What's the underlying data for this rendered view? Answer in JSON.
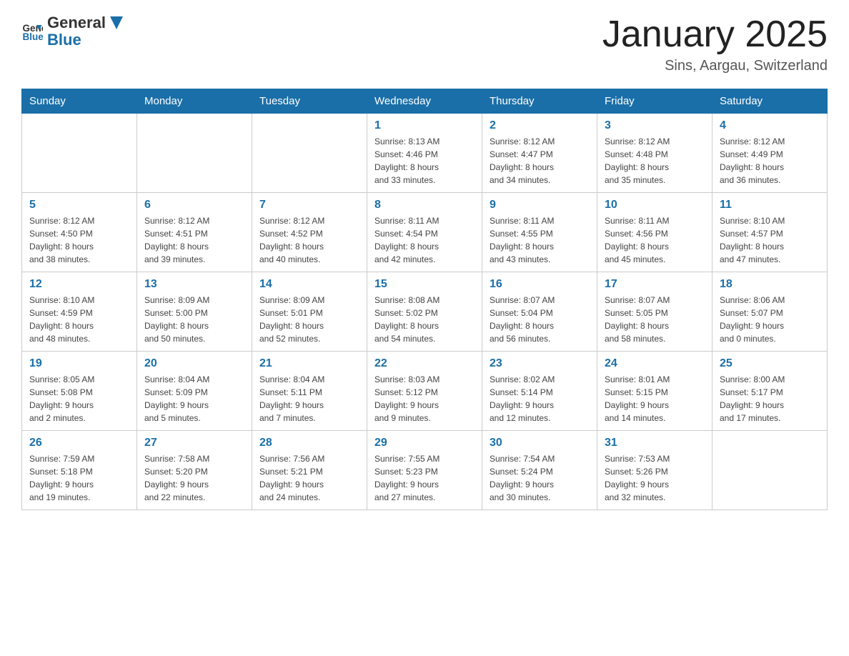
{
  "header": {
    "logo_general": "General",
    "logo_blue": "Blue",
    "title": "January 2025",
    "subtitle": "Sins, Aargau, Switzerland"
  },
  "days_of_week": [
    "Sunday",
    "Monday",
    "Tuesday",
    "Wednesday",
    "Thursday",
    "Friday",
    "Saturday"
  ],
  "weeks": [
    {
      "days": [
        {
          "number": "",
          "info": ""
        },
        {
          "number": "",
          "info": ""
        },
        {
          "number": "",
          "info": ""
        },
        {
          "number": "1",
          "info": "Sunrise: 8:13 AM\nSunset: 4:46 PM\nDaylight: 8 hours\nand 33 minutes."
        },
        {
          "number": "2",
          "info": "Sunrise: 8:12 AM\nSunset: 4:47 PM\nDaylight: 8 hours\nand 34 minutes."
        },
        {
          "number": "3",
          "info": "Sunrise: 8:12 AM\nSunset: 4:48 PM\nDaylight: 8 hours\nand 35 minutes."
        },
        {
          "number": "4",
          "info": "Sunrise: 8:12 AM\nSunset: 4:49 PM\nDaylight: 8 hours\nand 36 minutes."
        }
      ]
    },
    {
      "days": [
        {
          "number": "5",
          "info": "Sunrise: 8:12 AM\nSunset: 4:50 PM\nDaylight: 8 hours\nand 38 minutes."
        },
        {
          "number": "6",
          "info": "Sunrise: 8:12 AM\nSunset: 4:51 PM\nDaylight: 8 hours\nand 39 minutes."
        },
        {
          "number": "7",
          "info": "Sunrise: 8:12 AM\nSunset: 4:52 PM\nDaylight: 8 hours\nand 40 minutes."
        },
        {
          "number": "8",
          "info": "Sunrise: 8:11 AM\nSunset: 4:54 PM\nDaylight: 8 hours\nand 42 minutes."
        },
        {
          "number": "9",
          "info": "Sunrise: 8:11 AM\nSunset: 4:55 PM\nDaylight: 8 hours\nand 43 minutes."
        },
        {
          "number": "10",
          "info": "Sunrise: 8:11 AM\nSunset: 4:56 PM\nDaylight: 8 hours\nand 45 minutes."
        },
        {
          "number": "11",
          "info": "Sunrise: 8:10 AM\nSunset: 4:57 PM\nDaylight: 8 hours\nand 47 minutes."
        }
      ]
    },
    {
      "days": [
        {
          "number": "12",
          "info": "Sunrise: 8:10 AM\nSunset: 4:59 PM\nDaylight: 8 hours\nand 48 minutes."
        },
        {
          "number": "13",
          "info": "Sunrise: 8:09 AM\nSunset: 5:00 PM\nDaylight: 8 hours\nand 50 minutes."
        },
        {
          "number": "14",
          "info": "Sunrise: 8:09 AM\nSunset: 5:01 PM\nDaylight: 8 hours\nand 52 minutes."
        },
        {
          "number": "15",
          "info": "Sunrise: 8:08 AM\nSunset: 5:02 PM\nDaylight: 8 hours\nand 54 minutes."
        },
        {
          "number": "16",
          "info": "Sunrise: 8:07 AM\nSunset: 5:04 PM\nDaylight: 8 hours\nand 56 minutes."
        },
        {
          "number": "17",
          "info": "Sunrise: 8:07 AM\nSunset: 5:05 PM\nDaylight: 8 hours\nand 58 minutes."
        },
        {
          "number": "18",
          "info": "Sunrise: 8:06 AM\nSunset: 5:07 PM\nDaylight: 9 hours\nand 0 minutes."
        }
      ]
    },
    {
      "days": [
        {
          "number": "19",
          "info": "Sunrise: 8:05 AM\nSunset: 5:08 PM\nDaylight: 9 hours\nand 2 minutes."
        },
        {
          "number": "20",
          "info": "Sunrise: 8:04 AM\nSunset: 5:09 PM\nDaylight: 9 hours\nand 5 minutes."
        },
        {
          "number": "21",
          "info": "Sunrise: 8:04 AM\nSunset: 5:11 PM\nDaylight: 9 hours\nand 7 minutes."
        },
        {
          "number": "22",
          "info": "Sunrise: 8:03 AM\nSunset: 5:12 PM\nDaylight: 9 hours\nand 9 minutes."
        },
        {
          "number": "23",
          "info": "Sunrise: 8:02 AM\nSunset: 5:14 PM\nDaylight: 9 hours\nand 12 minutes."
        },
        {
          "number": "24",
          "info": "Sunrise: 8:01 AM\nSunset: 5:15 PM\nDaylight: 9 hours\nand 14 minutes."
        },
        {
          "number": "25",
          "info": "Sunrise: 8:00 AM\nSunset: 5:17 PM\nDaylight: 9 hours\nand 17 minutes."
        }
      ]
    },
    {
      "days": [
        {
          "number": "26",
          "info": "Sunrise: 7:59 AM\nSunset: 5:18 PM\nDaylight: 9 hours\nand 19 minutes."
        },
        {
          "number": "27",
          "info": "Sunrise: 7:58 AM\nSunset: 5:20 PM\nDaylight: 9 hours\nand 22 minutes."
        },
        {
          "number": "28",
          "info": "Sunrise: 7:56 AM\nSunset: 5:21 PM\nDaylight: 9 hours\nand 24 minutes."
        },
        {
          "number": "29",
          "info": "Sunrise: 7:55 AM\nSunset: 5:23 PM\nDaylight: 9 hours\nand 27 minutes."
        },
        {
          "number": "30",
          "info": "Sunrise: 7:54 AM\nSunset: 5:24 PM\nDaylight: 9 hours\nand 30 minutes."
        },
        {
          "number": "31",
          "info": "Sunrise: 7:53 AM\nSunset: 5:26 PM\nDaylight: 9 hours\nand 32 minutes."
        },
        {
          "number": "",
          "info": ""
        }
      ]
    }
  ]
}
